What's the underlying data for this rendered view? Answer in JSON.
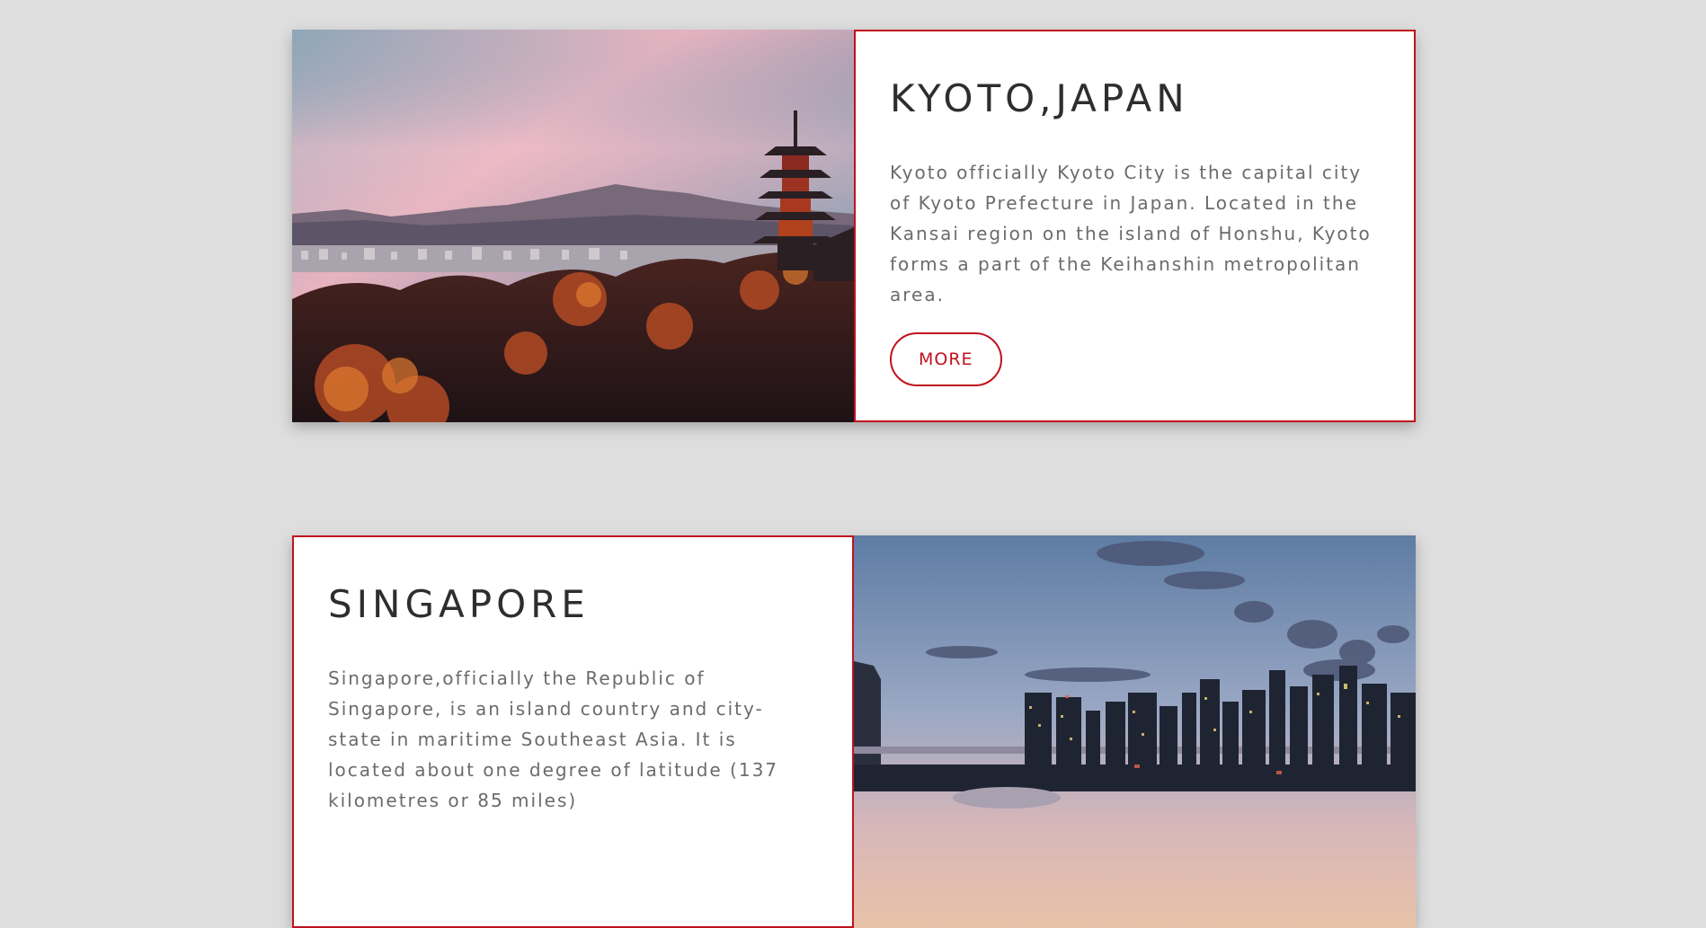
{
  "cards": [
    {
      "title": "KYOTO,JAPAN",
      "description": "Kyoto officially Kyoto City is the capital city of Kyoto Prefecture in Japan. Located in the Kansai region on the island of Honshu, Kyoto forms a part of the Keihanshin metropolitan area.",
      "button_label": "MORE",
      "image": "kyoto-pagoda-sunset-image"
    },
    {
      "title": "SINGAPORE",
      "description": "Singapore,officially the Republic of Singapore, is an island country and city-state in maritime Southeast Asia. It is located about one degree of latitude (137 kilometres or 85 miles)",
      "image": "singapore-skyline-dusk-image"
    }
  ],
  "colors": {
    "page_background": "#dedede",
    "accent": "#c1121f",
    "title_text": "#2e2e2e",
    "body_text": "#6b6b6b"
  }
}
